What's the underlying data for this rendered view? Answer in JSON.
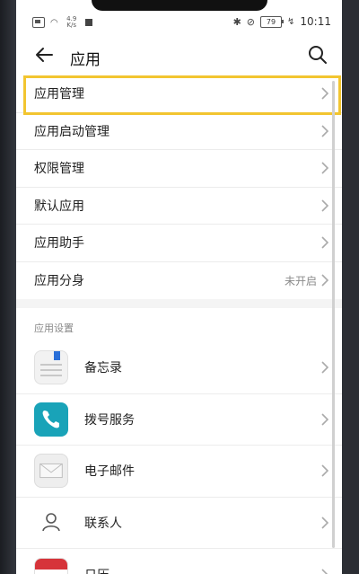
{
  "status_bar": {
    "speed_value": "4.9",
    "speed_unit": "K/s",
    "battery": "79",
    "time": "10:11"
  },
  "header": {
    "title": "应用"
  },
  "menu": [
    {
      "label": "应用管理",
      "value": ""
    },
    {
      "label": "应用启动管理",
      "value": ""
    },
    {
      "label": "权限管理",
      "value": ""
    },
    {
      "label": "默认应用",
      "value": ""
    },
    {
      "label": "应用助手",
      "value": ""
    },
    {
      "label": "应用分身",
      "value": "未开启"
    }
  ],
  "app_settings": {
    "section_label": "应用设置",
    "items": [
      {
        "label": "备忘录",
        "icon": "memo-icon"
      },
      {
        "label": "拨号服务",
        "icon": "phone-icon"
      },
      {
        "label": "电子邮件",
        "icon": "mail-icon"
      },
      {
        "label": "联系人",
        "icon": "contacts-icon"
      },
      {
        "label": "日历",
        "icon": "calendar-icon"
      }
    ]
  },
  "colors": {
    "highlight": "#f2c530",
    "phone_icon_bg": "#19a3b8",
    "calendar_red": "#d6343a"
  }
}
